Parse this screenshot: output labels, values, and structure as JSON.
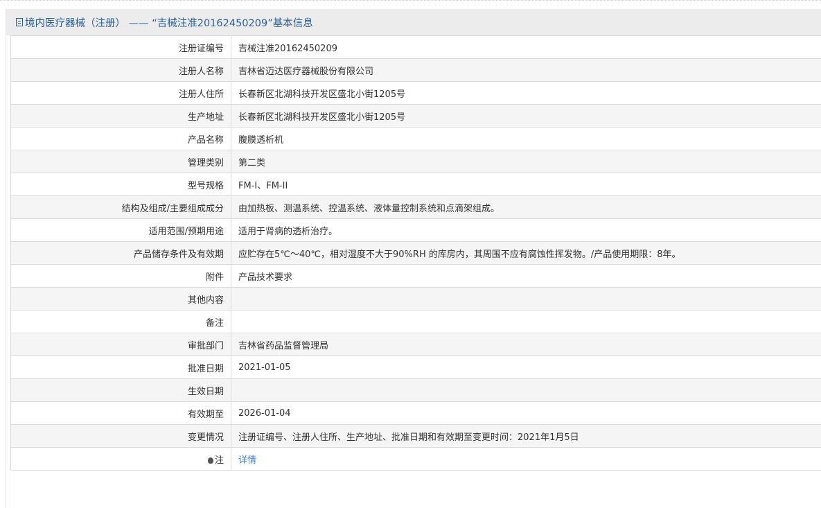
{
  "title": "境内医疗器械（注册） ——  “吉械注准20162450209”基本信息",
  "rows": [
    {
      "label": "注册证编号",
      "value": "吉械注准20162450209"
    },
    {
      "label": "注册人名称",
      "value": "吉林省迈达医疗器械股份有限公司"
    },
    {
      "label": "注册人住所",
      "value": "长春新区北湖科技开发区盛北小街1205号"
    },
    {
      "label": "生产地址",
      "value": "长春新区北湖科技开发区盛北小街1205号"
    },
    {
      "label": "产品名称",
      "value": "腹膜透析机"
    },
    {
      "label": "管理类别",
      "value": "第二类"
    },
    {
      "label": "型号规格",
      "value": "FM-I、FM-II"
    },
    {
      "label": "结构及组成/主要组成成分",
      "value": "由加热板、测温系统、控温系统、液体量控制系统和点滴架组成。"
    },
    {
      "label": "适用范围/预期用途",
      "value": "适用于肾病的透析治疗。"
    },
    {
      "label": "产品储存条件及有效期",
      "value": "应贮存在5℃～40℃，相对湿度不大于90%RH 的库房内，其周围不应有腐蚀性挥发物。/产品使用期限：8年。"
    },
    {
      "label": "附件",
      "value": "产品技术要求"
    },
    {
      "label": "其他内容",
      "value": ""
    },
    {
      "label": "备注",
      "value": ""
    },
    {
      "label": "审批部门",
      "value": "吉林省药品监督管理局"
    },
    {
      "label": "批准日期",
      "value": "2021-01-05"
    },
    {
      "label": "生效日期",
      "value": ""
    },
    {
      "label": "有效期至",
      "value": "2026-01-04"
    },
    {
      "label": "变更情况",
      "value": "注册证编号、注册人住所、生产地址、批准日期和有效期至变更时间：2021年1月5日"
    }
  ],
  "note": {
    "label": "注",
    "link": "详情"
  }
}
